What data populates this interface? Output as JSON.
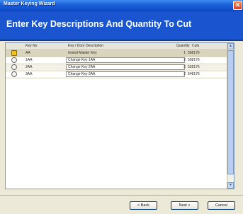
{
  "window": {
    "title": "Master Keying Wizard",
    "close_glyph": "✕"
  },
  "header": {
    "title": "Enter Key Descriptions And Quantity To Cut"
  },
  "table": {
    "columns": {
      "key_no": "Key No",
      "description": "Key / Door Description",
      "quantity": "Quantity",
      "cuts": "Cuts"
    },
    "rows": [
      {
        "key_no": "AA",
        "description": "Grand Master Key",
        "quantity": "1",
        "cuts": "568176",
        "icon": "selected-row-icon"
      },
      {
        "key_no": "1AA",
        "description": "Change Key 1AA",
        "quantity": "2",
        "cuts": "508176",
        "icon": "key-icon"
      },
      {
        "key_no": "2AA",
        "description": "Change Key 2AA",
        "quantity": "2",
        "cuts": "528176",
        "icon": "key-icon"
      },
      {
        "key_no": "3AA",
        "description": "Change Key 3AA",
        "quantity": "2",
        "cuts": "548176",
        "icon": "key-icon"
      }
    ]
  },
  "scrollbar": {
    "up": "▲",
    "down": "▼"
  },
  "buttons": {
    "back": "< Back",
    "next": "Next >",
    "cancel": "Cancel"
  }
}
